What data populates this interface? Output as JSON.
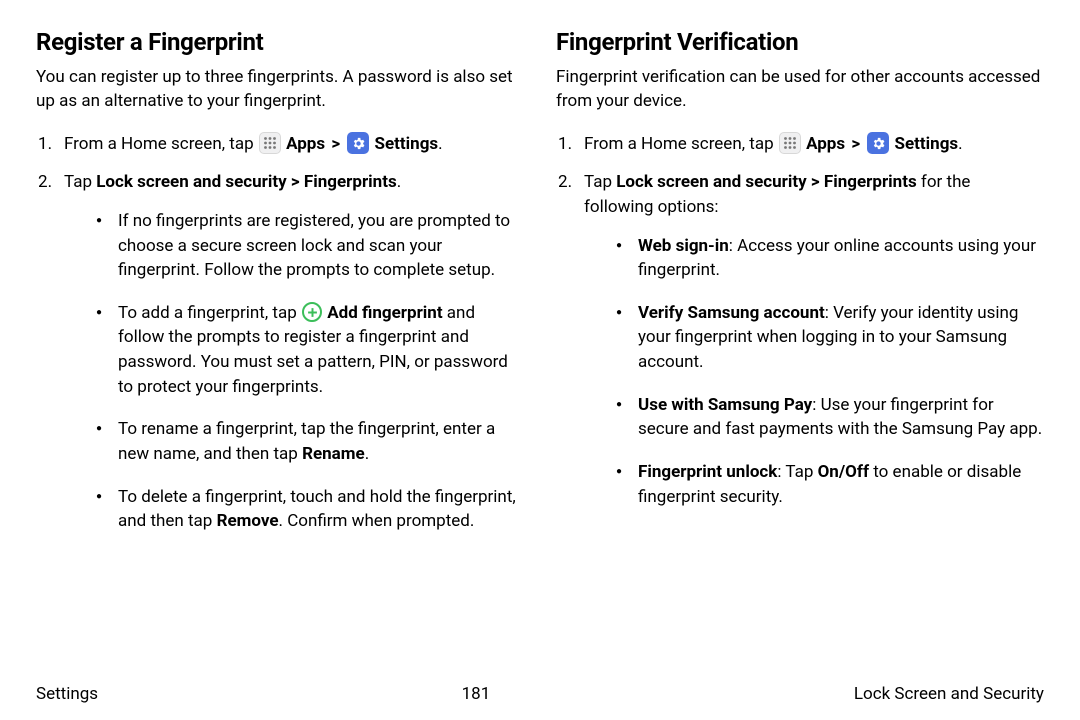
{
  "left": {
    "heading": "Register a Fingerprint",
    "intro": "You can register up to three fingerprints. A password is also set up as an alternative to your fingerprint.",
    "step1_pre": "From a Home screen, tap ",
    "apps": "Apps",
    "settings": "Settings",
    "step2_pre": "Tap ",
    "step2_bold": "Lock screen and security > Fingerprints",
    "b1": "If no fingerprints are registered, you are prompted to choose a secure screen lock and scan your fingerprint. Follow the prompts to complete setup.",
    "b2_pre": "To add a fingerprint, tap ",
    "b2_bold": "Add fingerprint",
    "b2_post": " and follow the prompts to register a fingerprint and password. You must set a pattern, PIN, or password to protect your fingerprints.",
    "b3_pre": "To rename a fingerprint, tap the fingerprint, enter a new name, and then tap ",
    "b3_bold": "Rename",
    "b4_pre": "To delete a fingerprint, touch and hold the fingerprint, and then tap ",
    "b4_bold": "Remove",
    "b4_post": ". Confirm when prompted."
  },
  "right": {
    "heading": "Fingerprint Verification",
    "intro": "Fingerprint verification can be used for other accounts accessed from your device.",
    "step1_pre": "From a Home screen, tap ",
    "apps": "Apps",
    "settings": "Settings",
    "step2_pre": "Tap ",
    "step2_bold": "Lock screen and security > Fingerprints",
    "step2_post": " for the following options:",
    "b1_bold": "Web sign-in",
    "b1_post": ": Access your online accounts using your fingerprint.",
    "b2_bold": "Verify Samsung account",
    "b2_post": ": Verify your identity using your fingerprint when logging in to your Samsung account.",
    "b3_bold": "Use with Samsung Pay",
    "b3_post": ": Use your fingerprint for secure and fast payments with the Samsung Pay app.",
    "b4_bold": "Fingerprint unlock",
    "b4_mid": ": Tap ",
    "b4_bold2": "On/Off",
    "b4_post": " to enable or disable fingerprint security."
  },
  "footer": {
    "left": "Settings",
    "center": "181",
    "right": "Lock Screen and Security"
  },
  "glyphs": {
    "chevron": ">"
  }
}
